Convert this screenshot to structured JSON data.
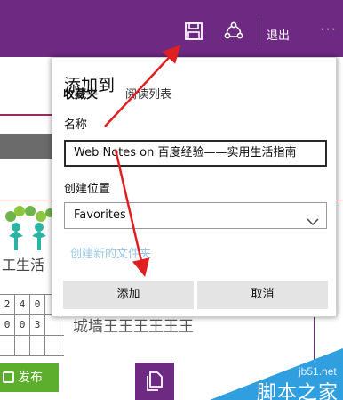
{
  "toolbar": {
    "save_icon": "save-icon",
    "share_icon": "share-icon",
    "exit_label": "退出",
    "more_label": "···",
    "bg_color": "#6e2a82"
  },
  "dialog": {
    "title": "添加到",
    "tabs": [
      "收藏夹",
      "阅读列表"
    ],
    "name_label": "名称",
    "name_value": "Web Notes on 百度经验——实用生活指南",
    "location_label": "创建位置",
    "location_value": "Favorites",
    "new_folder_link": "创建新的文件夹",
    "add_button": "添加",
    "cancel_button": "取消"
  },
  "background": {
    "publish_button": "发布",
    "grid_rows": [
      [
        "2",
        "4",
        "0",
        ""
      ],
      [
        "0",
        "0",
        "3",
        ""
      ],
      [
        "",
        "",
        "",
        ""
      ]
    ],
    "handwriting": "城墙王王王王王王",
    "side_handwriting": "工生活"
  },
  "watermark": {
    "site": "jb51.net",
    "name": "脚本之家"
  },
  "colors": {
    "accent": "#6e2a82",
    "arrow": "#e02020",
    "link": "#9bc7e6",
    "watermark": "#2f9fe0"
  }
}
